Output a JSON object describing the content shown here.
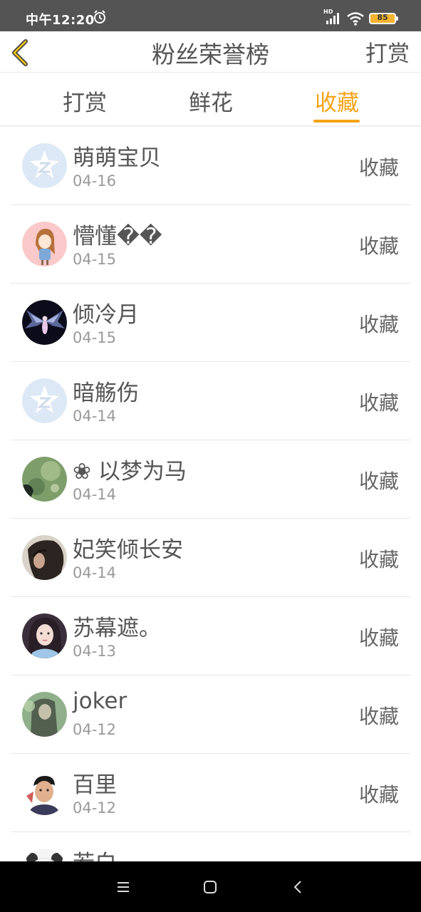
{
  "status_bar": {
    "time": "中午12:20",
    "network_badge": "HD",
    "battery": "85",
    "icons": [
      "alarm-icon",
      "signal-icon",
      "wifi-icon",
      "battery-icon"
    ]
  },
  "header": {
    "title": "粉丝荣誉榜",
    "action_label": "打赏",
    "back_icon": "chevron-left-icon"
  },
  "tabs": [
    {
      "label": "打赏",
      "active": false
    },
    {
      "label": "鲜花",
      "active": false
    },
    {
      "label": "收藏",
      "active": true
    }
  ],
  "colors": {
    "accent": "#f5a316",
    "status_bar": "#545454",
    "text": "#555555",
    "date": "#999999"
  },
  "fans": [
    {
      "name": "萌萌宝贝",
      "date": "04-16",
      "action": "收藏",
      "avatar": "default-qq-avatar"
    },
    {
      "name": "懵懂��",
      "date": "04-15",
      "action": "收藏",
      "avatar": "cartoon-girl-avatar"
    },
    {
      "name": "倾冷月",
      "date": "04-15",
      "action": "收藏",
      "avatar": "angel-wings-avatar"
    },
    {
      "name": "暗觞伤",
      "date": "04-14",
      "action": "收藏",
      "avatar": "default-qq-avatar"
    },
    {
      "name": "❀ 以梦为马",
      "date": "04-14",
      "action": "收藏",
      "avatar": "nature-photo-avatar"
    },
    {
      "name": "妃笑倾长安",
      "date": "04-14",
      "action": "收藏",
      "avatar": "long-hair-girl-avatar"
    },
    {
      "name": "苏幕遮。",
      "date": "04-13",
      "action": "收藏",
      "avatar": "portrait-girl-avatar"
    },
    {
      "name": "joker",
      "date": "04-12",
      "action": "收藏",
      "avatar": "green-photo-avatar"
    },
    {
      "name": "百里",
      "date": "04-12",
      "action": "收藏",
      "avatar": "boy-photo-avatar"
    },
    {
      "name": "若白",
      "date": "",
      "action": "",
      "avatar": "panda-avatar"
    }
  ],
  "nav_bar": {
    "buttons": [
      "menu-icon",
      "home-icon",
      "back-icon"
    ]
  }
}
